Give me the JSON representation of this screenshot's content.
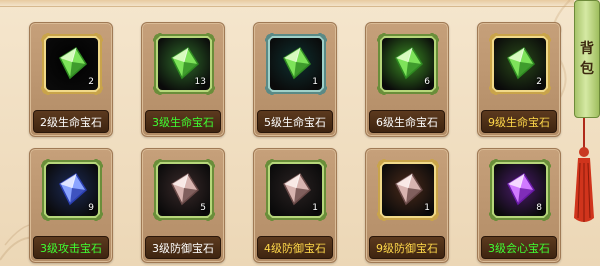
{
  "side_tab": {
    "chars": [
      "背",
      "包"
    ]
  },
  "colors": {
    "label_white": "#ffffff",
    "label_green": "#3fff32",
    "label_yellow": "#ffd84a"
  },
  "items": [
    {
      "name": "2级生命宝石",
      "count": "2",
      "gem": "green-gem-icon",
      "name_color": "#ffffff",
      "frame": "gold",
      "glow": "#000000"
    },
    {
      "name": "3级生命宝石",
      "count": "13",
      "gem": "green-gem-icon",
      "name_color": "#3fff32",
      "frame": "green",
      "glow": "#2f6a2a"
    },
    {
      "name": "5级生命宝石",
      "count": "1",
      "gem": "green-gem-icon",
      "name_color": "#ffffff",
      "frame": "teal",
      "glow": "#0f3030"
    },
    {
      "name": "6级生命宝石",
      "count": "6",
      "gem": "green-gem-icon",
      "name_color": "#ffffff",
      "frame": "green",
      "glow": "#3c8e24"
    },
    {
      "name": "9级生命宝石",
      "count": "2",
      "gem": "green-gem-icon",
      "name_color": "#ffd84a",
      "frame": "gold",
      "glow": "#2a4a1a"
    },
    {
      "name": "3级攻击宝石",
      "count": "9",
      "gem": "blue-gem-icon",
      "name_color": "#3fff32",
      "frame": "green",
      "glow": "#1c2a55"
    },
    {
      "name": "3级防御宝石",
      "count": "5",
      "gem": "pink-gem-icon",
      "name_color": "#ffffff",
      "frame": "green",
      "glow": "#3a2a2a"
    },
    {
      "name": "4级防御宝石",
      "count": "1",
      "gem": "pink-gem-icon",
      "name_color": "#ffd84a",
      "frame": "green",
      "glow": "#2a2222"
    },
    {
      "name": "9级防御宝石",
      "count": "1",
      "gem": "pink-gem-icon",
      "name_color": "#ffd84a",
      "frame": "gold",
      "glow": "#4a2a1a"
    },
    {
      "name": "3级会心宝石",
      "count": "8",
      "gem": "purple-gem-icon",
      "name_color": "#3fff32",
      "frame": "green",
      "glow": "#4a1c6a"
    }
  ]
}
